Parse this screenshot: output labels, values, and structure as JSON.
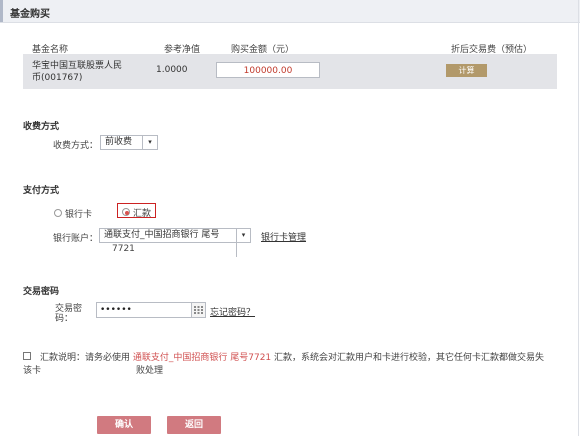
{
  "header": {
    "title": "基金购买"
  },
  "fund_table": {
    "headers": [
      "基金名称",
      "参考净值",
      "购买金额（元）",
      "折后交易费（预估）"
    ],
    "row": {
      "name_line1": "华宝中国互联股票人民",
      "name_line2": "币(001767)",
      "nav": "1.0000",
      "amount": "100000.00",
      "calc_label": "计算"
    }
  },
  "fee_section": {
    "title": "收费方式",
    "label": "收费方式：",
    "selected": "前收费"
  },
  "payment_section": {
    "title": "支付方式",
    "options": [
      {
        "label": "银行卡",
        "selected": false
      },
      {
        "label": "汇款",
        "selected": true
      }
    ],
    "account_label": "银行账户：",
    "account_line1": "通联支付_中国招商银行 尾号",
    "account_line2": "7721",
    "manage_link": "银行卡管理"
  },
  "password_section": {
    "title": "交易密码",
    "label_line1": "交易密",
    "label_line2": "码：",
    "value": "••••••",
    "forgot_link": "忘记密码？"
  },
  "remit_note": {
    "prefix": "汇款说明：请务必使用",
    "highlight": "通联支付_中国招商银行 尾号7721",
    "suffix": "汇款，系统会对汇款用户和卡进行校验，其它任何卡汇款都做交易失",
    "line2_left": "该卡",
    "line2_right": "败处理"
  },
  "actions": {
    "confirm": "确认",
    "back": "返回"
  },
  "colors": {
    "accent_red": "#d05050",
    "calc_button": "#b2996a",
    "action_button": "#d17a80"
  }
}
